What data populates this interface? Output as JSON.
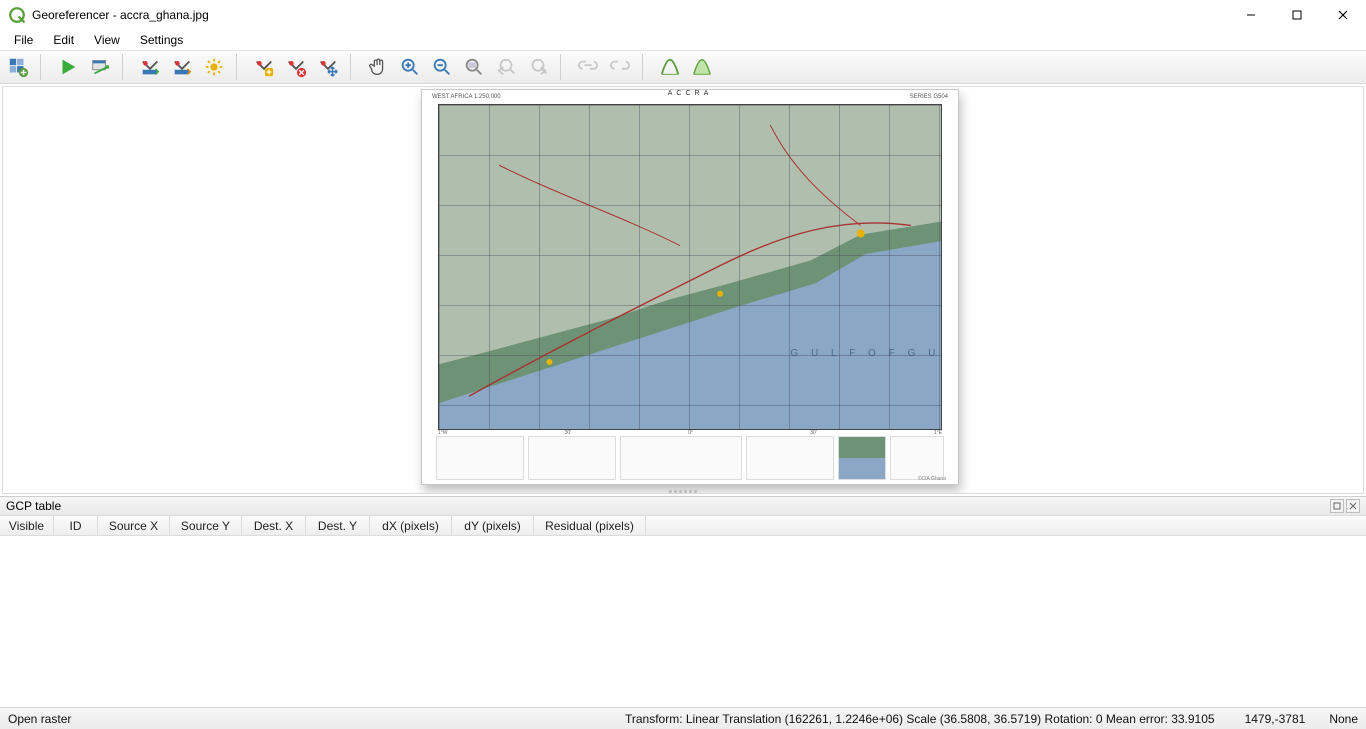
{
  "window": {
    "title": "Georeferencer - accra_ghana.jpg"
  },
  "menu": {
    "file": "File",
    "edit": "Edit",
    "view": "View",
    "settings": "Settings"
  },
  "toolbar": {
    "icons": {
      "open_raster": "open-raster-icon",
      "start": "start-georef-icon",
      "script": "generate-script-icon",
      "load_gcp": "load-gcp-icon",
      "save_gcp": "save-gcp-icon",
      "transform_settings": "transform-settings-icon",
      "add_point": "add-point-icon",
      "delete_point": "delete-point-icon",
      "move_point": "move-point-icon",
      "pan": "pan-icon",
      "zoom_in": "zoom-in-icon",
      "zoom_out": "zoom-out-icon",
      "zoom_layer": "zoom-to-layer-icon",
      "zoom_last": "zoom-last-icon",
      "zoom_next": "zoom-next-icon",
      "link_georef": "link-georef-icon",
      "link_qgis": "link-qgis-icon",
      "histogram": "full-histogram-icon",
      "local_histogram": "local-histogram-icon"
    }
  },
  "map": {
    "sheet_label": "ACCRA",
    "corner_left": "WEST AFRICA 1:250,000",
    "corner_right": "SERIES G504",
    "gulf_label": "GULF OF GUINEA",
    "credit": "©CIA Ghana"
  },
  "gcp": {
    "panel_title": "GCP table",
    "columns": {
      "visible": "Visible",
      "id": "ID",
      "srcx": "Source X",
      "srcy": "Source Y",
      "dstx": "Dest. X",
      "dsty": "Dest. Y",
      "dxp": "dX (pixels)",
      "dyp": "dY (pixels)",
      "resid": "Residual (pixels)"
    }
  },
  "status": {
    "left": "Open raster",
    "transform": "Transform: Linear Translation (162261, 1.2246e+06) Scale (36.5808, 36.5719) Rotation: 0 Mean error: 33.9105",
    "coords": "1479,-3781",
    "right": "None"
  }
}
